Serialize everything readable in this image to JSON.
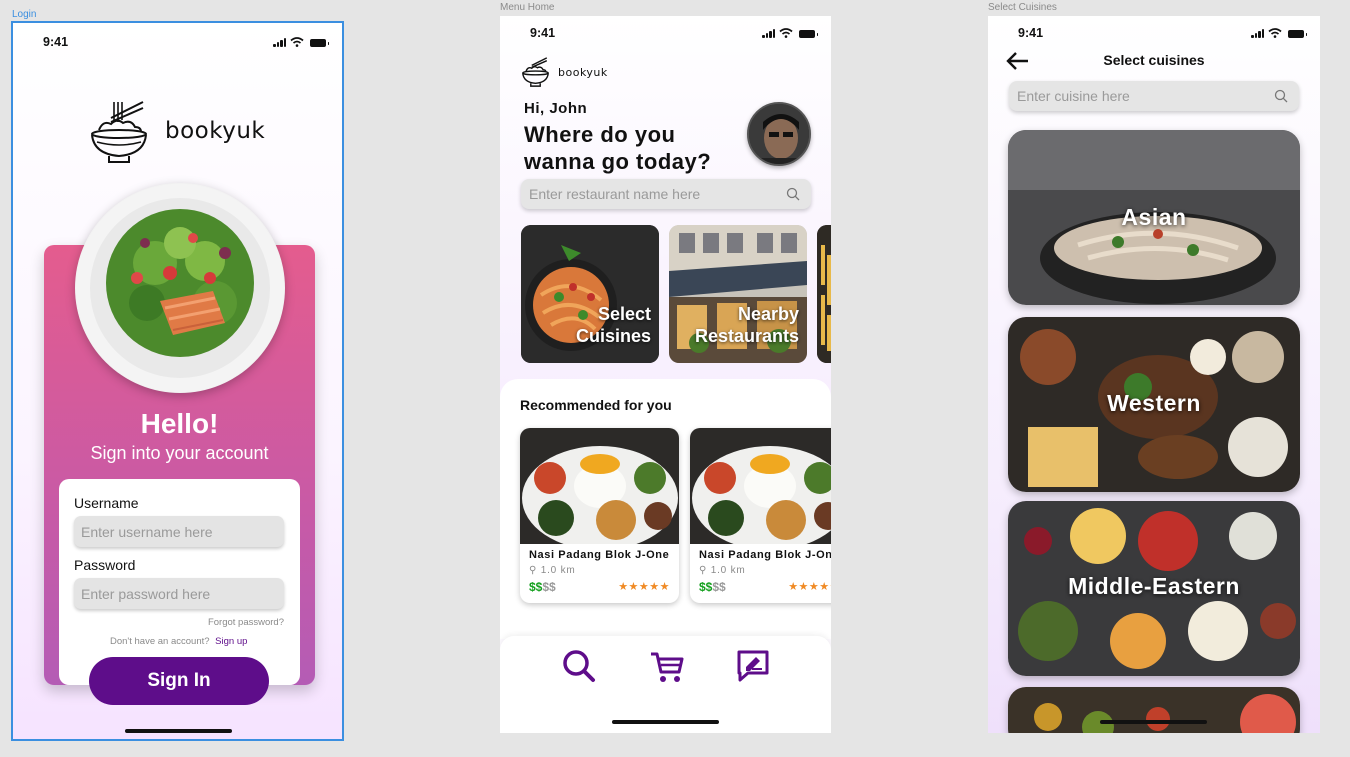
{
  "frames": {
    "login": "Login",
    "menu": "Menu Home",
    "cuisines": "Select Cuisines"
  },
  "status": {
    "time": "9:41"
  },
  "brand": {
    "name": "bookyuk"
  },
  "login": {
    "hello": "Hello!",
    "subtitle": "Sign into your account",
    "username_label": "Username",
    "username_placeholder": "Enter username here",
    "password_label": "Password",
    "password_placeholder": "Enter password here",
    "forgot": "Forgot password?",
    "no_account": "Don't have an account?",
    "signup": "Sign up",
    "signin": "Sign In"
  },
  "menu": {
    "greeting": "Hi, John",
    "headline_1": "Where do you",
    "headline_2": "wanna go today?",
    "search_placeholder": "Enter restaurant name here",
    "tiles": [
      {
        "line1": "Select",
        "line2": "Cuisines"
      },
      {
        "line1": "Nearby",
        "line2": "Restaurants"
      }
    ],
    "recommended_title": "Recommended for you",
    "cards": [
      {
        "title": "Nasi Padang Blok J-One",
        "distance": "1.0 km",
        "price_active": "$$",
        "price_inactive": "$$",
        "stars": "★★★★★"
      },
      {
        "title": "Nasi Padang Blok J-One",
        "distance": "1.0 km",
        "price_active": "$$",
        "price_inactive": "$$",
        "stars": "★★★★★"
      }
    ],
    "nav_icons": [
      "search-icon",
      "cart-icon",
      "edit-message-icon"
    ]
  },
  "cuisines": {
    "title": "Select cuisines",
    "search_placeholder": "Enter cuisine here",
    "items": [
      "Asian",
      "Western",
      "Middle-Eastern"
    ]
  },
  "colors": {
    "accent": "#5e0d8a",
    "pink": "#e45c8e",
    "star": "#f08a24",
    "price": "#14a01e"
  }
}
